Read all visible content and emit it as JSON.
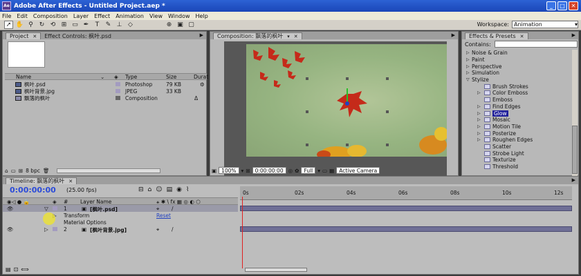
{
  "window": {
    "title": "Adobe After Effects - Untitled Project.aep *",
    "min": "_",
    "max": "□",
    "close": "✕"
  },
  "menu": [
    "File",
    "Edit",
    "Composition",
    "Layer",
    "Effect",
    "Animation",
    "View",
    "Window",
    "Help"
  ],
  "workspace": {
    "label": "Workspace:",
    "value": "Animation"
  },
  "project_panel": {
    "tabs": [
      "Project",
      "Effect Controls: 枫叶.psd"
    ],
    "columns": [
      "Name",
      "Type",
      "Size",
      "Durat"
    ],
    "rows": [
      {
        "name": "枫叶.psd",
        "type": "Photoshop",
        "size": "79 KB",
        "dur": ""
      },
      {
        "name": "枫叶背景.jpg",
        "type": "JPEG",
        "size": "33 KB",
        "dur": ""
      },
      {
        "name": "飘落的枫叶",
        "type": "Composition",
        "size": "",
        "dur": "Δ"
      }
    ],
    "footer_bpc": "8 bpc"
  },
  "composition_panel": {
    "tab": "Composition: 飘落的枫叶",
    "zoom": "100%",
    "timecode": "0:00:00:00",
    "resolution": "Full",
    "camera": "Active Camera"
  },
  "effects_panel": {
    "tab": "Effects & Presets",
    "contains_label": "Contains:",
    "categories_top": [
      "Noise & Grain",
      "Paint",
      "Perspective",
      "Simulation",
      "Stylize"
    ],
    "stylize_items": [
      "Brush Strokes",
      "Color Emboss",
      "Emboss",
      "Find Edges",
      "Glow",
      "Mosaic",
      "Motion Tile",
      "Posterize",
      "Roughen Edges",
      "Scatter",
      "Strobe Light",
      "Texturize",
      "Threshold"
    ],
    "highlighted": "Glow"
  },
  "timeline": {
    "tab": "Timeline: 飘落的枫叶",
    "time": "0:00:00:00",
    "fps": "(25.00 fps)",
    "ruler_labels": [
      "0s",
      "02s",
      "04s",
      "06s",
      "08s",
      "10s",
      "12s"
    ],
    "layer_col": "Layer Name",
    "hash": "#",
    "layers": [
      {
        "num": "1",
        "name": "[枫叶.psd]"
      },
      {
        "num": "2",
        "name": "[枫叶背景.jpg]"
      }
    ],
    "sub_transform": "Transform",
    "sub_reset": "Reset",
    "sub_material": "Material Options"
  },
  "colors": {
    "timecode": "#2b4bd9",
    "layer_bar": "#6f6f96",
    "cti": "#e02020",
    "highlight": "#20209a"
  }
}
